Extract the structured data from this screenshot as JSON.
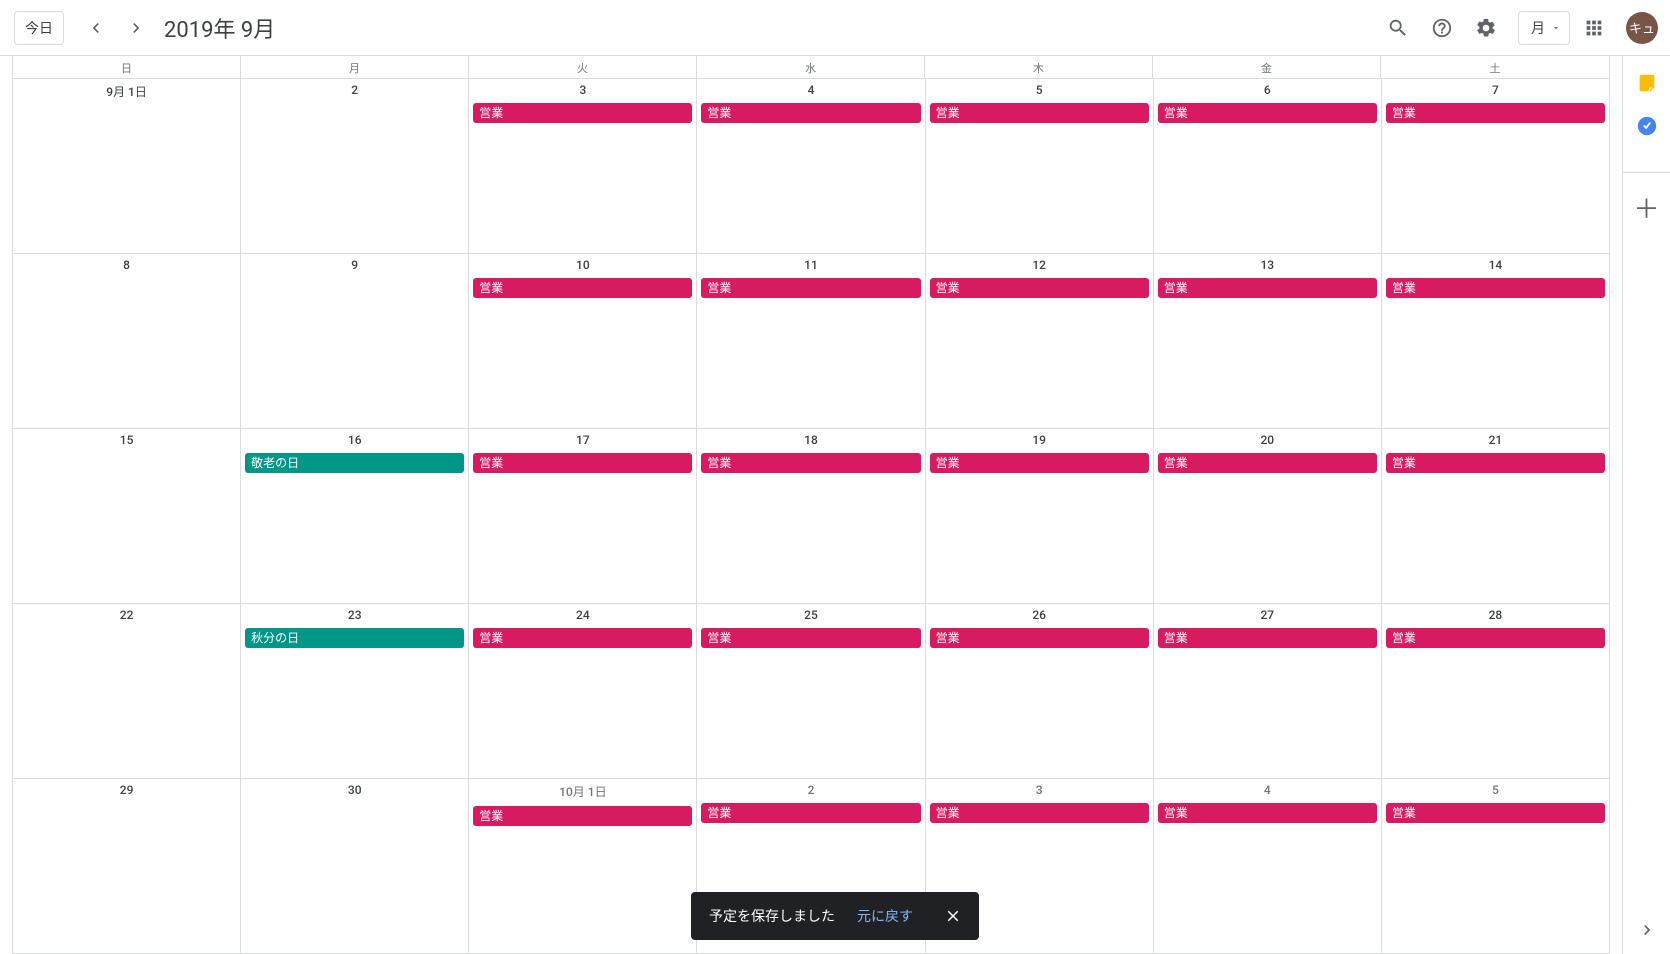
{
  "header": {
    "today": "今日",
    "title": "2019年 9月",
    "view": "月",
    "avatar": "キュ"
  },
  "dayHeaders": [
    "日",
    "月",
    "火",
    "水",
    "木",
    "金",
    "土"
  ],
  "weeks": [
    [
      {
        "label": "9月 1日",
        "other": false,
        "events": []
      },
      {
        "label": "2",
        "other": false,
        "events": []
      },
      {
        "label": "3",
        "other": false,
        "events": [
          {
            "title": "営業",
            "color": "pink"
          }
        ]
      },
      {
        "label": "4",
        "other": false,
        "events": [
          {
            "title": "営業",
            "color": "pink"
          }
        ]
      },
      {
        "label": "5",
        "other": false,
        "events": [
          {
            "title": "営業",
            "color": "pink"
          }
        ]
      },
      {
        "label": "6",
        "other": false,
        "events": [
          {
            "title": "営業",
            "color": "pink"
          }
        ]
      },
      {
        "label": "7",
        "other": false,
        "events": [
          {
            "title": "営業",
            "color": "pink"
          }
        ]
      }
    ],
    [
      {
        "label": "8",
        "other": false,
        "events": []
      },
      {
        "label": "9",
        "other": false,
        "events": []
      },
      {
        "label": "10",
        "other": false,
        "events": [
          {
            "title": "営業",
            "color": "pink"
          }
        ]
      },
      {
        "label": "11",
        "other": false,
        "events": [
          {
            "title": "営業",
            "color": "pink"
          }
        ]
      },
      {
        "label": "12",
        "other": false,
        "events": [
          {
            "title": "営業",
            "color": "pink"
          }
        ]
      },
      {
        "label": "13",
        "other": false,
        "events": [
          {
            "title": "営業",
            "color": "pink"
          }
        ]
      },
      {
        "label": "14",
        "other": false,
        "events": [
          {
            "title": "営業",
            "color": "pink"
          }
        ]
      }
    ],
    [
      {
        "label": "15",
        "other": false,
        "events": []
      },
      {
        "label": "16",
        "other": false,
        "events": [
          {
            "title": "敬老の日",
            "color": "teal"
          }
        ]
      },
      {
        "label": "17",
        "other": false,
        "events": [
          {
            "title": "営業",
            "color": "pink"
          }
        ]
      },
      {
        "label": "18",
        "other": false,
        "events": [
          {
            "title": "営業",
            "color": "pink"
          }
        ]
      },
      {
        "label": "19",
        "other": false,
        "events": [
          {
            "title": "営業",
            "color": "pink"
          }
        ]
      },
      {
        "label": "20",
        "other": false,
        "events": [
          {
            "title": "営業",
            "color": "pink"
          }
        ]
      },
      {
        "label": "21",
        "other": false,
        "events": [
          {
            "title": "営業",
            "color": "pink"
          }
        ]
      }
    ],
    [
      {
        "label": "22",
        "other": false,
        "events": []
      },
      {
        "label": "23",
        "other": false,
        "events": [
          {
            "title": "秋分の日",
            "color": "teal"
          }
        ]
      },
      {
        "label": "24",
        "other": false,
        "events": [
          {
            "title": "営業",
            "color": "pink"
          }
        ]
      },
      {
        "label": "25",
        "other": false,
        "events": [
          {
            "title": "営業",
            "color": "pink"
          }
        ]
      },
      {
        "label": "26",
        "other": false,
        "events": [
          {
            "title": "営業",
            "color": "pink"
          }
        ]
      },
      {
        "label": "27",
        "other": false,
        "events": [
          {
            "title": "営業",
            "color": "pink"
          }
        ]
      },
      {
        "label": "28",
        "other": false,
        "events": [
          {
            "title": "営業",
            "color": "pink"
          }
        ]
      }
    ],
    [
      {
        "label": "29",
        "other": false,
        "events": []
      },
      {
        "label": "30",
        "other": false,
        "events": []
      },
      {
        "label": "10月 1日",
        "other": true,
        "events": [
          {
            "title": "営業",
            "color": "pink"
          }
        ]
      },
      {
        "label": "2",
        "other": true,
        "events": [
          {
            "title": "営業",
            "color": "pink"
          }
        ]
      },
      {
        "label": "3",
        "other": true,
        "events": [
          {
            "title": "営業",
            "color": "pink"
          }
        ]
      },
      {
        "label": "4",
        "other": true,
        "events": [
          {
            "title": "営業",
            "color": "pink"
          }
        ]
      },
      {
        "label": "5",
        "other": true,
        "events": [
          {
            "title": "営業",
            "color": "pink"
          }
        ]
      }
    ]
  ],
  "toast": {
    "msg": "予定を保存しました",
    "undo": "元に戻す"
  }
}
